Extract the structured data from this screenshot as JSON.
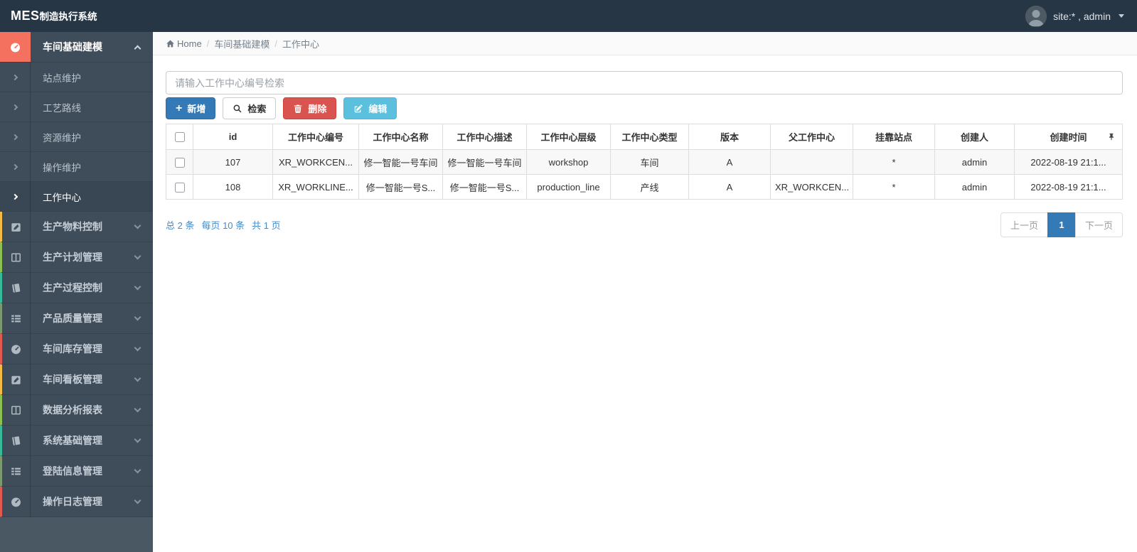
{
  "navbar": {
    "logo_mes": "MES",
    "logo_suffix": "制造执行系统",
    "user_label": "site:* , admin"
  },
  "breadcrumb": {
    "home": "Home",
    "section": "车间基础建模",
    "current": "工作中心"
  },
  "search": {
    "placeholder": "请输入工作中心编号检索",
    "value": ""
  },
  "toolbar": {
    "add_label": "新增",
    "search_label": "检索",
    "delete_label": "删除",
    "edit_label": "编辑"
  },
  "sidebar": {
    "active_group": {
      "label": "车间基础建模",
      "icon": "dashboard-icon"
    },
    "submenu": [
      {
        "label": "站点维护"
      },
      {
        "label": "工艺路线"
      },
      {
        "label": "资源维护"
      },
      {
        "label": "操作维护"
      },
      {
        "label": "工作中心",
        "active": true
      }
    ],
    "groups": [
      {
        "label": "生产物料控制",
        "icon": "edit-icon",
        "border_color": "#f6bb42"
      },
      {
        "label": "生产计划管理",
        "icon": "columns-icon",
        "border_color": "#8cc152"
      },
      {
        "label": "生产过程控制",
        "icon": "book-icon",
        "border_color": "#37bc9b"
      },
      {
        "label": "产品质量管理",
        "icon": "list-icon",
        "border_color": "#7d9a6f"
      },
      {
        "label": "车间库存管理",
        "icon": "dashboard-icon",
        "border_color": "#e25950"
      },
      {
        "label": "车间看板管理",
        "icon": "edit-icon",
        "border_color": "#f6bb42"
      },
      {
        "label": "数据分析报表",
        "icon": "columns-icon",
        "border_color": "#8cc152"
      },
      {
        "label": "系统基础管理",
        "icon": "book-icon",
        "border_color": "#37bc9b"
      },
      {
        "label": "登陆信息管理",
        "icon": "list-icon",
        "border_color": "#7d9a6f"
      },
      {
        "label": "操作日志管理",
        "icon": "dashboard-icon",
        "border_color": "#e25950"
      }
    ]
  },
  "table": {
    "headers": [
      "id",
      "工作中心编号",
      "工作中心名称",
      "工作中心描述",
      "工作中心层级",
      "工作中心类型",
      "版本",
      "父工作中心",
      "挂靠站点",
      "创建人",
      "创建时间"
    ],
    "rows": [
      {
        "id": "107",
        "code": "XR_WORKCEN...",
        "name": "修一智能一号车间",
        "desc": "修一智能一号车间",
        "level": "workshop",
        "type": "车间",
        "version": "A",
        "parent": "",
        "station": "*",
        "creator": "admin",
        "created": "2022-08-19 21:1..."
      },
      {
        "id": "108",
        "code": "XR_WORKLINE...",
        "name": "修一智能一号S...",
        "desc": "修一智能一号S...",
        "level": "production_line",
        "type": "产线",
        "version": "A",
        "parent": "XR_WORKCEN...",
        "station": "*",
        "creator": "admin",
        "created": "2022-08-19 21:1..."
      }
    ]
  },
  "pagination": {
    "total": "总 2 条",
    "per_page": "每页 10 条",
    "pages": "共 1 页",
    "prev_label": "上一页",
    "page": "1",
    "next_label": "下一页"
  },
  "colors": {
    "navbar_bg": "#273645",
    "sidebar_bg": "#4a5863",
    "sidebar_item_bg": "#3f4d5b",
    "active_group_icon_bg": "#f4705f",
    "primary_button": "#337ab7",
    "danger_button": "#d9534f",
    "info_button": "#5bc0de",
    "active_page_bg": "#337ab7",
    "pager_info_text": "#428bca"
  }
}
